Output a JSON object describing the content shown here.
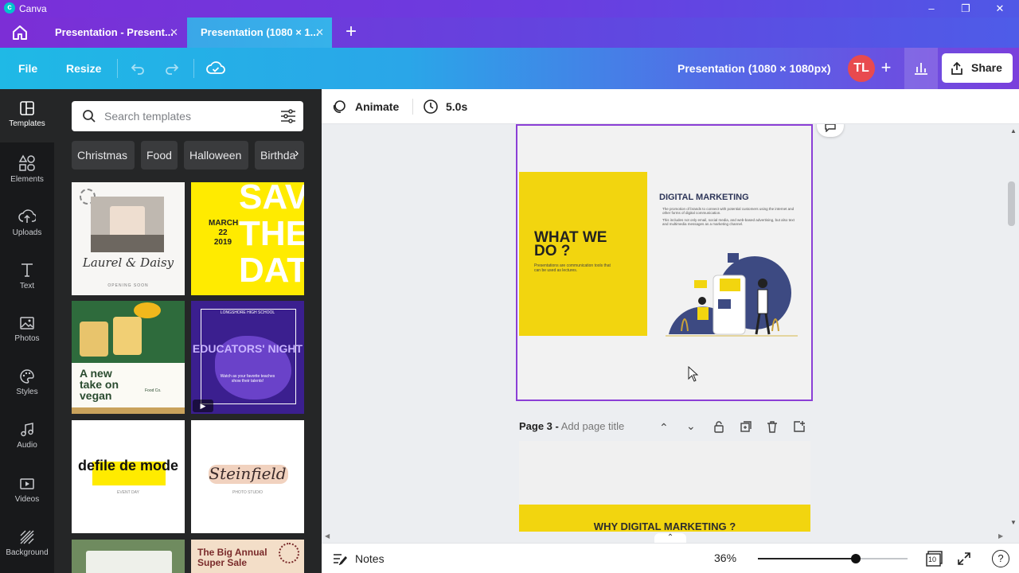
{
  "window": {
    "title": "Canva"
  },
  "tabs": [
    {
      "label": "Presentation - Present..."
    },
    {
      "label": "Presentation (1080 × 1..."
    }
  ],
  "toolbar": {
    "file": "File",
    "resize": "Resize",
    "doc_title": "Presentation (1080 × 1080px)",
    "avatar": "TL",
    "share": "Share"
  },
  "rail": [
    {
      "label": "Templates",
      "icon": "templates-icon"
    },
    {
      "label": "Elements",
      "icon": "elements-icon"
    },
    {
      "label": "Uploads",
      "icon": "upload-icon"
    },
    {
      "label": "Text",
      "icon": "text-icon"
    },
    {
      "label": "Photos",
      "icon": "photos-icon"
    },
    {
      "label": "Styles",
      "icon": "styles-icon"
    },
    {
      "label": "Audio",
      "icon": "audio-icon"
    },
    {
      "label": "Videos",
      "icon": "videos-icon"
    },
    {
      "label": "Background",
      "icon": "background-icon"
    }
  ],
  "search": {
    "placeholder": "Search templates"
  },
  "chips": [
    "Christmas",
    "Food",
    "Halloween",
    "Birthda"
  ],
  "templates": {
    "t1": {
      "title": "Laurel & Daisy",
      "sub": "OPENING SOON"
    },
    "t2": {
      "date": "MARCH 22 2019",
      "big": "SAVE THE DATE"
    },
    "t3": {
      "title": "A new take on vegan",
      "brand": "Food Co."
    },
    "t4": {
      "school": "LONGSHORE HIGH SCHOOL",
      "title": "EDUCATORS' NIGHT",
      "sub": "Watch as your favorite teaches show their talents!"
    },
    "t5": {
      "title": "defile de mode",
      "sub": "EVENT DAY"
    },
    "t6": {
      "title": "Steinfield",
      "sub": "PHOTO STUDIO"
    },
    "t8": {
      "title": "The Big Annual Super Sale"
    }
  },
  "editor": {
    "animate": "Animate",
    "duration": "5.0s"
  },
  "slide": {
    "heading": "WHAT WE DO ?",
    "subtext": "Presentations are communication tools that can be used as lectures.",
    "right_title": "DIGITAL MARKETING",
    "bullet1": "The promotion of brands to connect with potential customers using the internet and other forms of digital communication.",
    "bullet2": "This includes not only email, social media, and web-based advertising, but also text and multimedia messages as a marketing channel."
  },
  "page3": {
    "label": "Page 3 -",
    "placeholder": "Add page title",
    "slide_title": "WHY DIGITAL MARKETING ?"
  },
  "bottom": {
    "notes": "Notes",
    "zoom": "36%",
    "zoom_level": 0.36,
    "pages": "10"
  },
  "colors": {
    "accent_purple": "#8b3fd6",
    "slide_yellow": "#f2d50f",
    "navy": "#3d4a82",
    "avatar": "#e84a4f"
  }
}
